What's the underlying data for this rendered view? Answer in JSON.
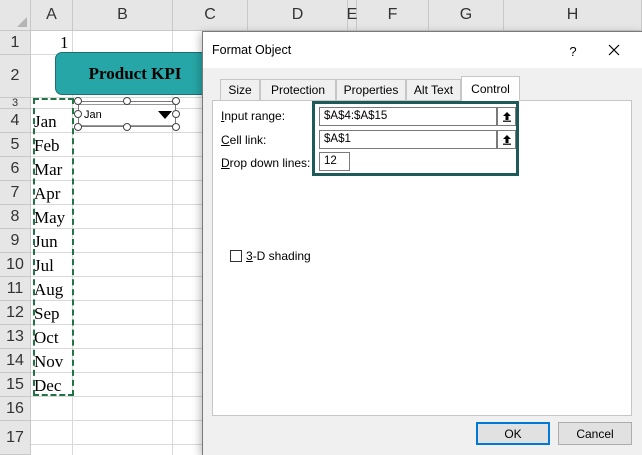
{
  "sheet": {
    "columns": [
      "A",
      "B",
      "C",
      "D",
      "E",
      "F",
      "G",
      "H"
    ],
    "rows": [
      "1",
      "2",
      "3",
      "4",
      "5",
      "6",
      "7",
      "8",
      "9",
      "10",
      "11",
      "12",
      "13",
      "14",
      "15",
      "16",
      "17"
    ],
    "a1_value": "1",
    "kpi_label": "Product KPI",
    "months": [
      "Jan",
      "Feb",
      "Mar",
      "Apr",
      "May",
      "Jun",
      "Jul",
      "Aug",
      "Sep",
      "Oct",
      "Nov",
      "Dec"
    ],
    "combo_value": "Jan"
  },
  "dialog": {
    "title": "Format Object",
    "help_label": "?",
    "tabs": [
      {
        "label": "Size",
        "active": false
      },
      {
        "label": "Protection",
        "active": false
      },
      {
        "label": "Properties",
        "active": false
      },
      {
        "label": "Alt Text",
        "active": false
      },
      {
        "label": "Control",
        "active": true
      }
    ],
    "control": {
      "input_range_label_hot": "I",
      "input_range_label_rest": "nput range:",
      "input_range_value": "$A$4:$A$15",
      "cell_link_label_hot": "C",
      "cell_link_label_rest": "ell link:",
      "cell_link_value": "$A$1",
      "drop_down_label_hot": "D",
      "drop_down_label_rest": "rop down lines:",
      "drop_down_value": "12",
      "shading_label_hot": "3",
      "shading_label_rest": "-D shading",
      "shading_checked": false
    },
    "buttons": {
      "ok": "OK",
      "cancel": "Cancel"
    }
  },
  "colors": {
    "kpi_fill": "#27a6a7",
    "highlight_border": "#1f5a5b",
    "marquee": "#217346",
    "ok_focus": "#0078d7"
  }
}
